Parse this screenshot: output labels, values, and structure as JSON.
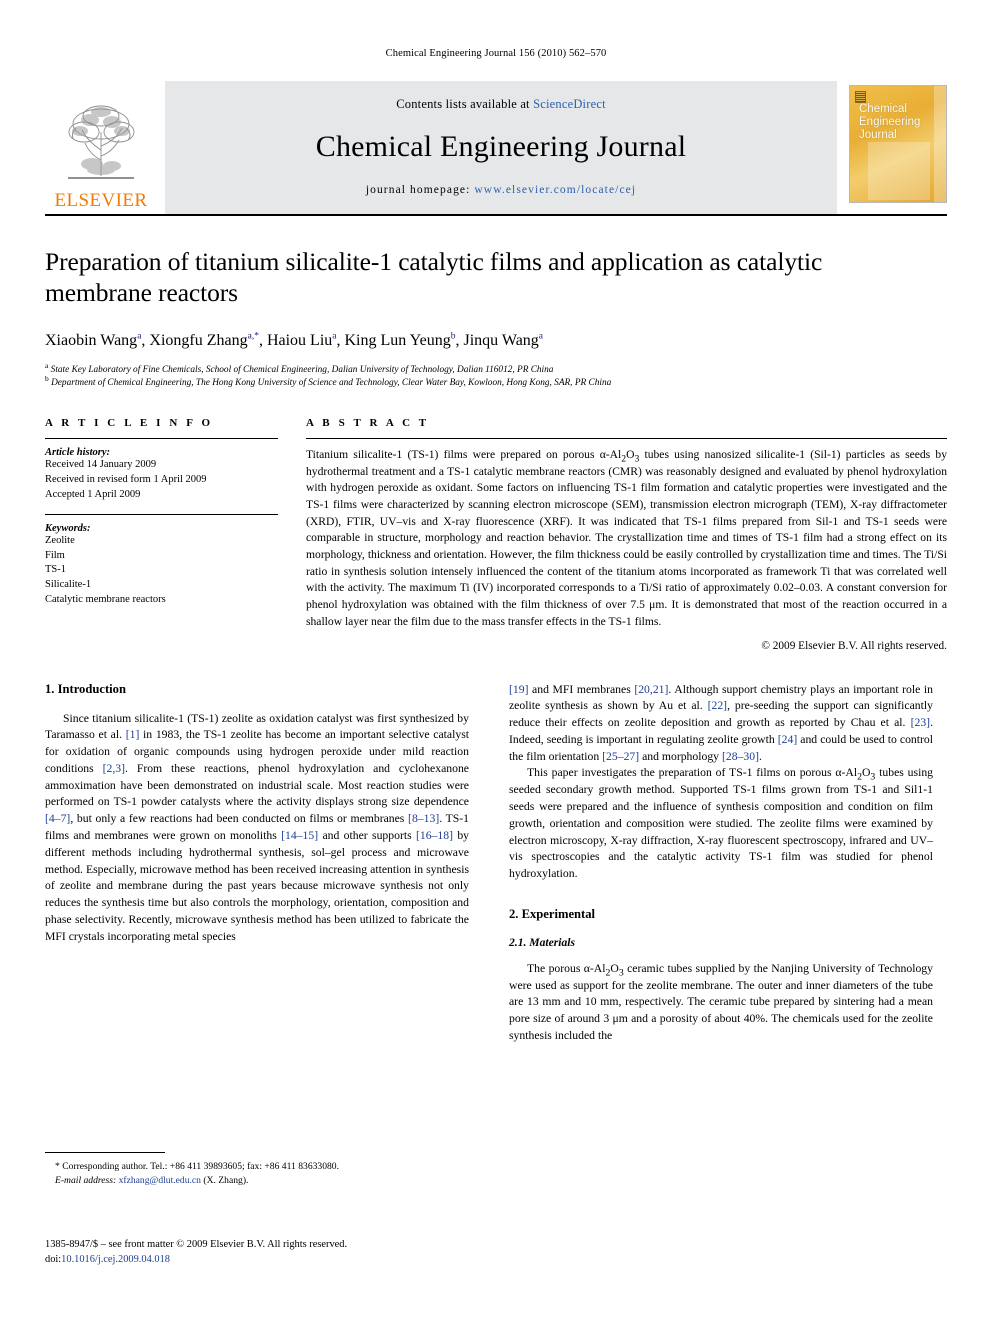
{
  "running_head": "Chemical Engineering Journal 156 (2010) 562–570",
  "masthead": {
    "contents_prefix": "Contents lists available at ",
    "sciencedirect": "ScienceDirect",
    "journal_name": "Chemical Engineering Journal",
    "homepage_prefix": "journal homepage: ",
    "homepage_url": "www.elsevier.com/locate/cej",
    "publisher": "ELSEVIER",
    "cover_title": "Chemical Engineering Journal",
    "accent_orange": "#f07d00",
    "link_blue": "#2b61ae",
    "band_gray": "#e6e7e8"
  },
  "article": {
    "title": "Preparation of titanium silicalite-1 catalytic films and application as catalytic membrane reactors",
    "authors": "Xiaobin Wanga, Xiongfu Zhanga,*, Haiou Liua, King Lun Yeungb, Jinqu Wanga",
    "affiliation_a": "State Key Laboratory of Fine Chemicals, School of Chemical Engineering, Dalian University of Technology, Dalian 116012, PR China",
    "affiliation_b": "Department of Chemical Engineering, The Hong Kong University of Science and Technology, Clear Water Bay, Kowloon, Hong Kong, SAR, PR China"
  },
  "article_info": {
    "heading": "A R T I C L E  I N F O",
    "history_label": "Article history:",
    "history": [
      "Received 14 January 2009",
      "Received in revised form 1 April 2009",
      "Accepted 1 April 2009"
    ],
    "keywords_label": "Keywords:",
    "keywords": [
      "Zeolite",
      "Film",
      "TS-1",
      "Silicalite-1",
      "Catalytic membrane reactors"
    ]
  },
  "abstract": {
    "heading": "A B S T R A C T",
    "text": "Titanium silicalite-1 (TS-1) films were prepared on porous α-Al2O3 tubes using nanosized silicalite-1 (Sil-1) particles as seeds by hydrothermal treatment and a TS-1 catalytic membrane reactors (CMR) was reasonably designed and evaluated by phenol hydroxylation with hydrogen peroxide as oxidant. Some factors on influencing TS-1 film formation and catalytic properties were investigated and the TS-1 films were characterized by scanning electron microscope (SEM), transmission electron micrograph (TEM), X-ray diffractometer (XRD), FTIR, UV–vis and X-ray fluorescence (XRF). It was indicated that TS-1 films prepared from Sil-1 and TS-1 seeds were comparable in structure, morphology and reaction behavior. The crystallization time and times of TS-1 film had a strong effect on its morphology, thickness and orientation. However, the film thickness could be easily controlled by crystallization time and times. The Ti/Si ratio in synthesis solution intensely influenced the content of the titanium atoms incorporated as framework Ti that was correlated well with the activity. The maximum Ti (IV) incorporated corresponds to a Ti/Si ratio of approximately 0.02–0.03. A constant conversion for phenol hydroxylation was obtained with the film thickness of over 7.5 μm. It is demonstrated that most of the reaction occurred in a shallow layer near the film due to the mass transfer effects in the TS-1 films.",
    "copyright": "© 2009 Elsevier B.V. All rights reserved."
  },
  "sections": {
    "introduction_heading": "1.  Introduction",
    "intro_p1": "Since titanium silicalite-1 (TS-1) zeolite as oxidation catalyst was first synthesized by Taramasso et al. [1] in 1983, the TS-1 zeolite has become an important selective catalyst for oxidation of organic compounds using hydrogen peroxide under mild reaction conditions [2,3]. From these reactions, phenol hydroxylation and cyclohexanone ammoximation have been demonstrated on industrial scale. Most reaction studies were performed on TS-1 powder catalysts where the activity displays strong size dependence [4–7], but only a few reactions had been conducted on films or membranes [8–13]. TS-1 films and membranes were grown on monoliths [14–15] and other supports [16–18] by different methods including hydrothermal synthesis, sol–gel process and microwave method. Especially, microwave method has been received increasing attention in synthesis of zeolite and membrane during the past years because microwave synthesis not only reduces the synthesis time but also controls the morphology, orientation, composition and phase selectivity. Recently, microwave synthesis method has been utilized to fabricate the MFI crystals incorporating metal species",
    "intro_p1_cont": "[19] and MFI membranes [20,21]. Although support chemistry plays an important role in zeolite synthesis as shown by Au et al. [22], pre-seeding the support can significantly reduce their effects on zeolite deposition and growth as reported by Chau et al. [23]. Indeed, seeding is important in regulating zeolite growth [24] and could be used to control the film orientation [25–27] and morphology [28–30].",
    "intro_p2": "This paper investigates the preparation of TS-1 films on porous α-Al2O3 tubes using seeded secondary growth method. Supported TS-1 films grown from TS-1 and Sil1-1 seeds were prepared and the influence of synthesis composition and condition on film growth, orientation and composition were studied. The zeolite films were examined by electron microscopy, X-ray diffraction, X-ray fluorescent spectroscopy, infrared and UV–vis spectroscopies and the catalytic activity TS-1 film was studied for phenol hydroxylation.",
    "experimental_heading": "2.  Experimental",
    "materials_heading": "2.1.  Materials",
    "materials_p1": "The porous α-Al2O3 ceramic tubes supplied by the Nanjing University of Technology were used as support for the zeolite membrane. The outer and inner diameters of the tube are 13 mm and 10 mm, respectively. The ceramic tube prepared by sintering had a mean pore size of around 3 μm and a porosity of about 40%. The chemicals used for the zeolite synthesis included the"
  },
  "footnote": {
    "corresponding": "* Corresponding author. Tel.: +86 411 39893605; fax: +86 411 83633080.",
    "email_label": "E-mail address:",
    "email": "xfzhang@dlut.edu.cn",
    "email_suffix": "(X. Zhang)."
  },
  "footer": {
    "issn_line": "1385-8947/$ – see front matter © 2009 Elsevier B.V. All rights reserved.",
    "doi_label": "doi:",
    "doi": "10.1016/j.cej.2009.04.018"
  }
}
